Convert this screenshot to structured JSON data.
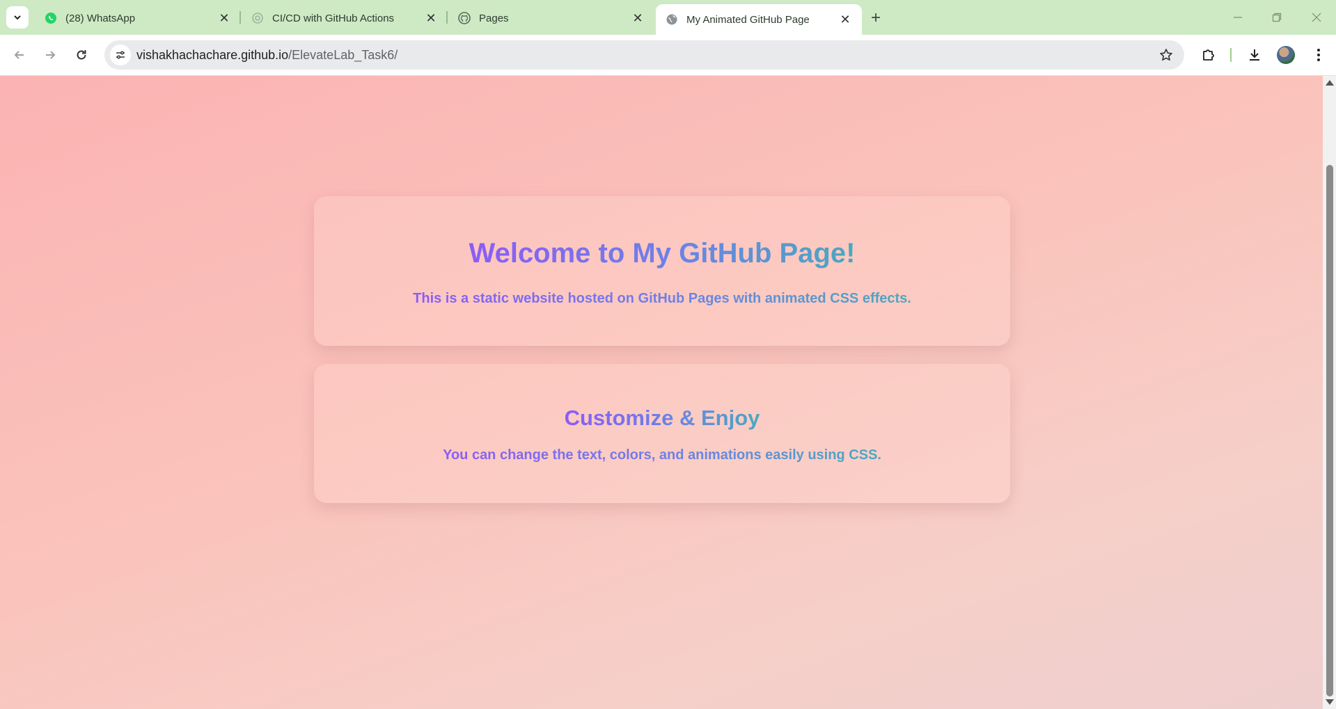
{
  "browser": {
    "tabs": [
      {
        "title": "(28) WhatsApp",
        "icon": "whatsapp-icon"
      },
      {
        "title": "CI/CD with GitHub Actions",
        "icon": "chatgpt-icon"
      },
      {
        "title": "Pages",
        "icon": "github-icon"
      },
      {
        "title": "My Animated GitHub Page",
        "icon": "globe-icon",
        "active": true
      }
    ],
    "address": {
      "host": "vishakhachachare.github.io",
      "path": "/ElevateLab_Task6/"
    }
  },
  "page": {
    "card1": {
      "heading": "Welcome to My GitHub Page!",
      "text": "This is a static website hosted on GitHub Pages with animated CSS effects."
    },
    "card2": {
      "heading": "Customize & Enjoy",
      "text": "You can change the text, colors, and animations easily using CSS."
    }
  },
  "colors": {
    "tabstrip": "#cdeac4",
    "gradient_start": "#8b5cf6",
    "gradient_end": "#4aa8c0",
    "page_bg": "#fbb3b3"
  }
}
